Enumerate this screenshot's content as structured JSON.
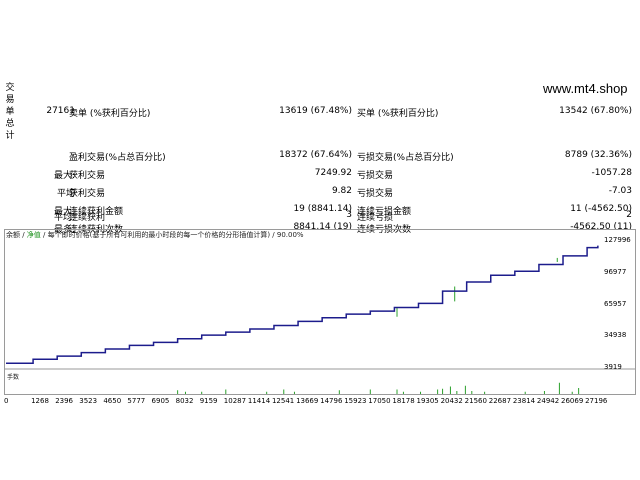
{
  "site": "www.mt4.shop",
  "side_label": [
    "交",
    "易",
    "单",
    "总",
    "计"
  ],
  "stats": [
    {
      "c1": "27161",
      "c2": "卖单 (%获利百分比)",
      "c3": "13619 (67.48%)",
      "c4": "买单 (%获利百分比)",
      "c5": "13542 (67.80%)"
    },
    {
      "c1": "",
      "c2": "",
      "c3": "",
      "c4": "",
      "c5": ""
    },
    {
      "c1": "",
      "c2": "盈利交易(%占总百分比)",
      "c3": "18372 (67.64%)",
      "c4": "亏损交易(%占总百分比)",
      "c5": "8789 (32.36%)"
    },
    {
      "c1": "最大:",
      "c2": "获利交易",
      "c3": "7249.92",
      "c4": "亏损交易",
      "c5": "-1057.28"
    },
    {
      "c1": "平均",
      "c2": "获利交易",
      "c3": "9.82",
      "c4": "亏损交易",
      "c5": "-7.03"
    },
    {
      "c1": "最大:",
      "c2": "连续获利金额",
      "c3": "19 (8841.14)",
      "c4": "连续亏损金额",
      "c5": "11 (-4562.50)"
    },
    {
      "c1": "最多:",
      "c2": "连续获利次数",
      "c3": "8841.14 (19)",
      "c4": "连续亏损次数",
      "c5": "-4562.50 (11)"
    },
    {
      "c1": "平均:",
      "c2": "连续获利",
      "c3": "3",
      "c4": "连续亏损",
      "c5": "2"
    }
  ],
  "legend": {
    "balance": "余额",
    "sep": " / ",
    "equity": "净值",
    "rest": " / 每个即时价格(基于所有可利用的最小时段的每一个价格的分形插值计算) / 90.00%"
  },
  "volume_label": "手数",
  "chart_data": {
    "type": "line",
    "title": "",
    "xlabel": "",
    "ylabel": "",
    "x_ticks": [
      "0",
      "1268",
      "2396",
      "3523",
      "4650",
      "5777",
      "6905",
      "8032",
      "9159",
      "10287",
      "11414",
      "12541",
      "13669",
      "14796",
      "15923",
      "17050",
      "18178",
      "19305",
      "20432",
      "21560",
      "22687",
      "23814",
      "24942",
      "26069",
      "27196"
    ],
    "y_ticks": [
      3919,
      34938,
      65957,
      96977,
      127996
    ],
    "xlim": [
      0,
      27800
    ],
    "ylim": [
      3919,
      127996
    ],
    "series": [
      {
        "name": "余额",
        "color": "#1c1c8c",
        "x": [
          0,
          1268,
          2396,
          3523,
          4650,
          5777,
          6905,
          8032,
          9159,
          10287,
          11414,
          12541,
          13669,
          14796,
          15923,
          17050,
          18178,
          19305,
          20432,
          21560,
          22687,
          23814,
          24942,
          26069,
          27196,
          27700
        ],
        "y": [
          8500,
          12500,
          15500,
          19000,
          22500,
          26000,
          29000,
          32500,
          36000,
          39000,
          42000,
          45500,
          49500,
          53000,
          56500,
          59500,
          63000,
          67000,
          79000,
          88000,
          94500,
          98500,
          105000,
          113500,
          121500,
          123500
        ]
      }
    ],
    "equity_dips": [
      {
        "x": 8032,
        "y": 30000
      },
      {
        "x": 17050,
        "y": 57000
      },
      {
        "x": 18300,
        "y": 54000
      },
      {
        "x": 20432,
        "y": 76000
      },
      {
        "x": 21000,
        "y": 69000
      },
      {
        "x": 25800,
        "y": 107500
      }
    ],
    "volume_bars": [
      {
        "x": 8032,
        "v": 0.5
      },
      {
        "x": 8400,
        "v": 0.3
      },
      {
        "x": 9159,
        "v": 0.3
      },
      {
        "x": 10287,
        "v": 0.6
      },
      {
        "x": 12200,
        "v": 0.3
      },
      {
        "x": 13000,
        "v": 0.6
      },
      {
        "x": 13500,
        "v": 0.3
      },
      {
        "x": 15600,
        "v": 0.5
      },
      {
        "x": 17050,
        "v": 0.6
      },
      {
        "x": 18300,
        "v": 0.6
      },
      {
        "x": 18600,
        "v": 0.3
      },
      {
        "x": 19400,
        "v": 0.3
      },
      {
        "x": 20200,
        "v": 0.6
      },
      {
        "x": 20432,
        "v": 0.7
      },
      {
        "x": 20800,
        "v": 1.0
      },
      {
        "x": 21100,
        "v": 0.4
      },
      {
        "x": 21500,
        "v": 1.1
      },
      {
        "x": 21800,
        "v": 0.4
      },
      {
        "x": 22400,
        "v": 0.3
      },
      {
        "x": 24300,
        "v": 0.3
      },
      {
        "x": 25200,
        "v": 0.4
      },
      {
        "x": 25900,
        "v": 1.5
      },
      {
        "x": 26500,
        "v": 0.3
      },
      {
        "x": 26800,
        "v": 0.8
      }
    ],
    "grid": false,
    "legend_position": "top-left"
  }
}
